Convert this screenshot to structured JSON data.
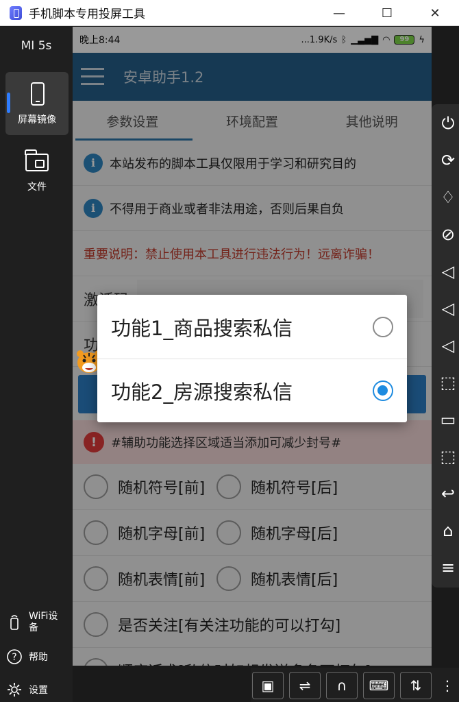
{
  "window": {
    "title": "手机脚本专用投屏工具",
    "minimize": "—",
    "maximize": "☐",
    "close": "✕"
  },
  "sidebar": {
    "device_name": "MI 5s",
    "items": [
      {
        "label": "屏幕镜像",
        "icon": "phone-mirror-icon"
      },
      {
        "label": "文件",
        "icon": "folder-icon"
      }
    ],
    "bottom": [
      {
        "label": "WiFi设备",
        "icon": "wifi-device-icon"
      },
      {
        "label": "帮助",
        "icon": "help-icon"
      },
      {
        "label": "设置",
        "icon": "gear-icon"
      }
    ]
  },
  "phone": {
    "status": {
      "time": "晚上8:44",
      "net_speed": "...1.9K/s",
      "battery": "99"
    },
    "appbar": {
      "title": "安卓助手1.2"
    },
    "tabs": [
      "参数设置",
      "环境配置",
      "其他说明"
    ],
    "notices": [
      "本站发布的脚本工具仅限用于学习和研究目的",
      "不得用于商业或者非法用途，否则后果自负"
    ],
    "warning": "重要说明：禁止使用本工具进行违法行为！远离诈骗！",
    "activation_label": "激活码",
    "function_label": "功",
    "alert": "#辅助功能选择区域适当添加可减少封号#",
    "options": [
      [
        "随机符号[前]",
        "随机符号[后]"
      ],
      [
        "随机字母[前]",
        "随机字母[后]"
      ],
      [
        "随机表情[前]",
        "随机表情[后]"
      ],
      [
        "是否关注[有关注功能的可以打勾]"
      ],
      [
        "顺序话术[私信时如想发送多条可打勾]"
      ]
    ]
  },
  "dialog": {
    "items": [
      {
        "label": "功能1_商品搜索私信",
        "selected": false
      },
      {
        "label": "功能2_房源搜索私信",
        "selected": true
      }
    ]
  },
  "right_toolbar": [
    "power-icon",
    "rotate-icon",
    "light-on-icon",
    "light-off-icon",
    "volume-up-icon",
    "volume-down-icon",
    "mute-icon",
    "screenshot-icon",
    "record-icon",
    "crop-icon",
    "back-icon",
    "home-icon",
    "menu-icon"
  ],
  "bottom_toolbar": [
    "window-icon",
    "usb-device-icon",
    "bluetooth-headset-icon",
    "keyboard-icon",
    "transfer-icon",
    "more-icon"
  ],
  "colors": {
    "appbar": "#255f8a",
    "accent": "#2c7fc7",
    "warning": "#c0392b",
    "radio_on": "#1d8be0"
  }
}
